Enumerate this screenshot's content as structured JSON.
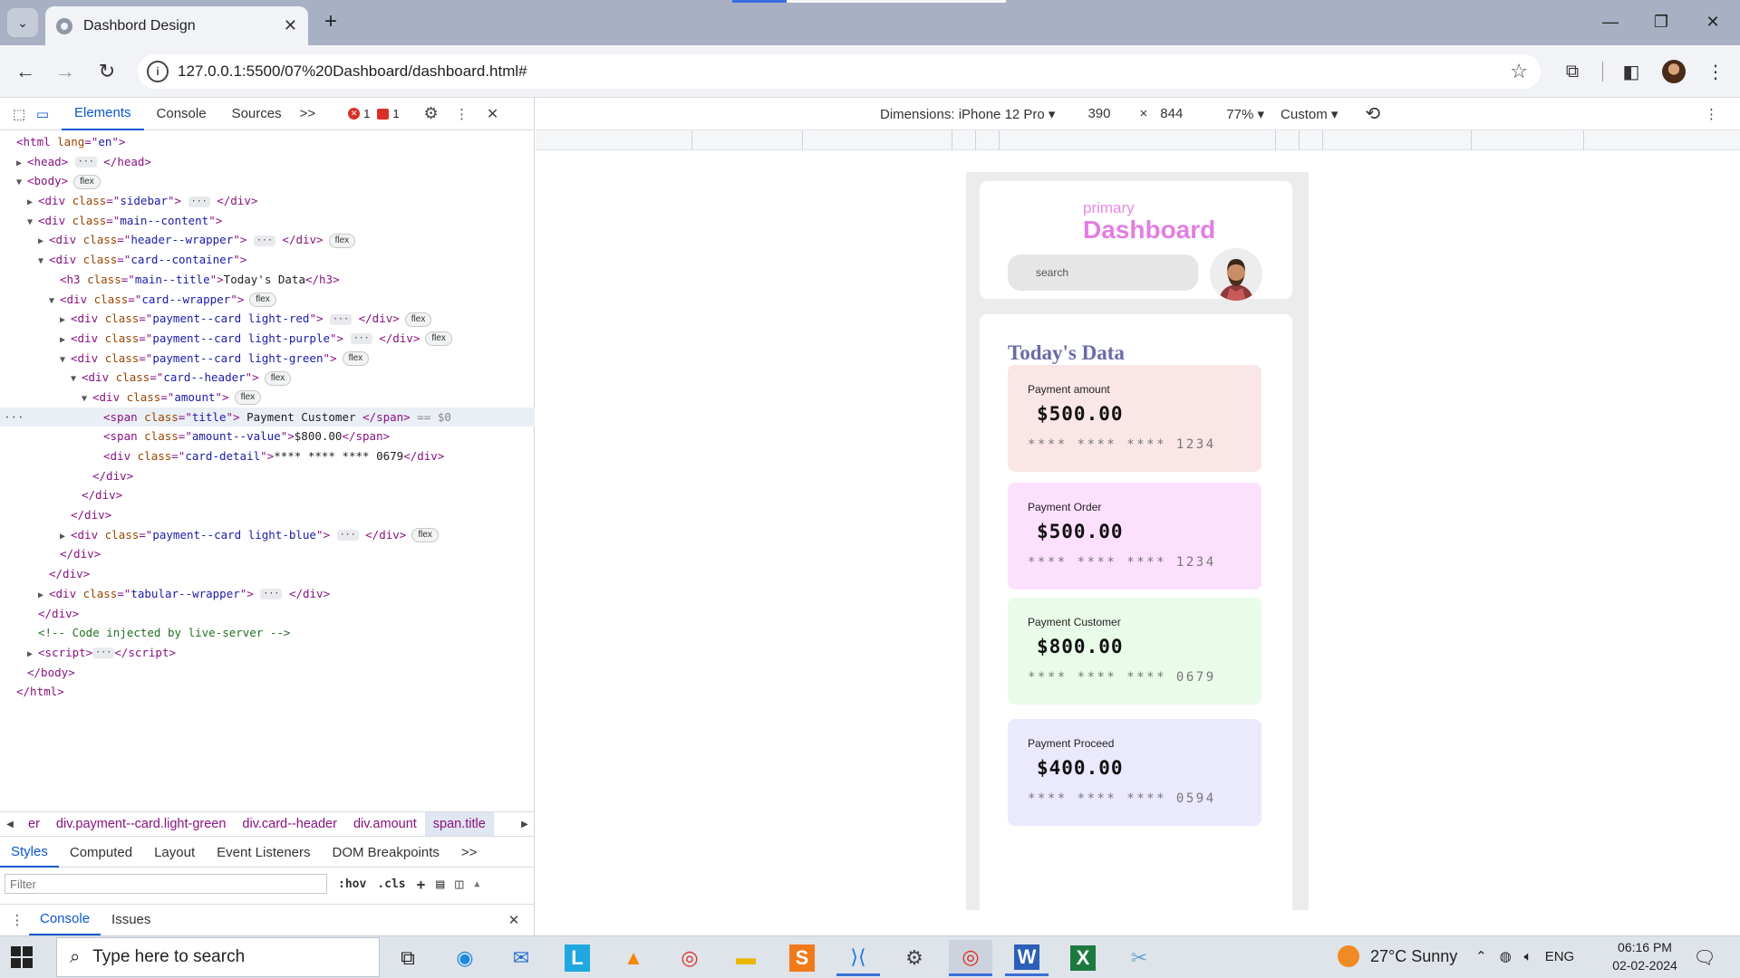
{
  "browser": {
    "tab_title": "Dashbord Design",
    "url": "127.0.0.1:5500/07%20Dashboard/dashboard.html#"
  },
  "devtools": {
    "tabs": [
      "Elements",
      "Console",
      "Sources"
    ],
    "more_tabs": ">>",
    "errors": "1",
    "issues": "1",
    "dom_lines": [
      {
        "indent": 1,
        "html": "<span class=\"t-tag\">&lt;html </span><span class=\"t-attr\">lang</span><span class=\"t-tag\">=\"</span><span class=\"t-val\">en</span><span class=\"t-tag\">\"&gt;</span>"
      },
      {
        "indent": 2,
        "tri": "right",
        "html": "<span class=\"t-tag\">&lt;head&gt;</span> <span class=\"ell\">···</span> <span class=\"t-tag\">&lt;/head&gt;</span>"
      },
      {
        "indent": 2,
        "tri": "down",
        "html": "<span class=\"t-tag\">&lt;body&gt;</span>",
        "badge": "flex"
      },
      {
        "indent": 3,
        "tri": "right",
        "html": "<span class=\"t-tag\">&lt;div </span><span class=\"t-attr\">class</span><span class=\"t-tag\">=\"</span><span class=\"t-val\">sidebar</span><span class=\"t-tag\">\"&gt;</span> <span class=\"ell\">···</span> <span class=\"t-tag\">&lt;/div&gt;</span>"
      },
      {
        "indent": 3,
        "tri": "down",
        "html": "<span class=\"t-tag\">&lt;div </span><span class=\"t-attr\">class</span><span class=\"t-tag\">=\"</span><span class=\"t-val\">main--content</span><span class=\"t-tag\">\"&gt;</span>"
      },
      {
        "indent": 4,
        "tri": "right",
        "html": "<span class=\"t-tag\">&lt;div </span><span class=\"t-attr\">class</span><span class=\"t-tag\">=\"</span><span class=\"t-val\">header--wrapper</span><span class=\"t-tag\">\"&gt;</span> <span class=\"ell\">···</span> <span class=\"t-tag\">&lt;/div&gt;</span>",
        "badge": "flex"
      },
      {
        "indent": 4,
        "tri": "down",
        "html": "<span class=\"t-tag\">&lt;div </span><span class=\"t-attr\">class</span><span class=\"t-tag\">=\"</span><span class=\"t-val\">card--container</span><span class=\"t-tag\">\"&gt;</span>"
      },
      {
        "indent": 5,
        "html": "<span class=\"t-tag\">&lt;h3 </span><span class=\"t-attr\">class</span><span class=\"t-tag\">=\"</span><span class=\"t-val\">main--title</span><span class=\"t-tag\">\"&gt;</span><span class=\"t-text\">Today's Data</span><span class=\"t-tag\">&lt;/h3&gt;</span>"
      },
      {
        "indent": 5,
        "tri": "down",
        "html": "<span class=\"t-tag\">&lt;div </span><span class=\"t-attr\">class</span><span class=\"t-tag\">=\"</span><span class=\"t-val\">card--wrapper</span><span class=\"t-tag\">\"&gt;</span>",
        "badge": "flex"
      },
      {
        "indent": 6,
        "tri": "right",
        "html": "<span class=\"t-tag\">&lt;div </span><span class=\"t-attr\">class</span><span class=\"t-tag\">=\"</span><span class=\"t-val\">payment--card light-red</span><span class=\"t-tag\">\"&gt;</span> <span class=\"ell\">···</span> <span class=\"t-tag\">&lt;/div&gt;</span>",
        "badge": "flex"
      },
      {
        "indent": 6,
        "tri": "right",
        "html": "<span class=\"t-tag\">&lt;div </span><span class=\"t-attr\">class</span><span class=\"t-tag\">=\"</span><span class=\"t-val\">payment--card light-purple</span><span class=\"t-tag\">\"&gt;</span> <span class=\"ell\">···</span> <span class=\"t-tag\">&lt;/div&gt;</span>",
        "badge": "flex"
      },
      {
        "indent": 6,
        "tri": "down",
        "html": "<span class=\"t-tag\">&lt;div </span><span class=\"t-attr\">class</span><span class=\"t-tag\">=\"</span><span class=\"t-val\">payment--card light-green</span><span class=\"t-tag\">\"&gt;</span>",
        "badge": "flex"
      },
      {
        "indent": 7,
        "tri": "down",
        "html": "<span class=\"t-tag\">&lt;div </span><span class=\"t-attr\">class</span><span class=\"t-tag\">=\"</span><span class=\"t-val\">card--header</span><span class=\"t-tag\">\"&gt;</span>",
        "badge": "flex"
      },
      {
        "indent": 8,
        "tri": "down",
        "html": "<span class=\"t-tag\">&lt;div </span><span class=\"t-attr\">class</span><span class=\"t-tag\">=\"</span><span class=\"t-val\">amount</span><span class=\"t-tag\">\"&gt;</span>",
        "badge": "flex"
      },
      {
        "indent": 9,
        "selected": true,
        "html": "<span class=\"t-tag\">&lt;span </span><span class=\"t-attr\">class</span><span class=\"t-tag\">=\"</span><span class=\"t-val\">title</span><span class=\"t-tag\">\"&gt;</span><span class=\"t-text\"> Payment Customer </span><span class=\"t-tag\">&lt;/span&gt;</span> <span class=\"t-dim\">== $0</span>"
      },
      {
        "indent": 9,
        "html": "<span class=\"t-tag\">&lt;span </span><span class=\"t-attr\">class</span><span class=\"t-tag\">=\"</span><span class=\"t-val\">amount--value</span><span class=\"t-tag\">\"&gt;</span><span class=\"t-text\">$800.00</span><span class=\"t-tag\">&lt;/span&gt;</span>"
      },
      {
        "indent": 9,
        "html": "<span class=\"t-tag\">&lt;div </span><span class=\"t-attr\">class</span><span class=\"t-tag\">=\"</span><span class=\"t-val\">card-detail</span><span class=\"t-tag\">\"&gt;</span><span class=\"t-text\">**** **** **** 0679</span><span class=\"t-tag\">&lt;/div&gt;</span>"
      },
      {
        "indent": 8,
        "html": "<span class=\"t-tag\">&lt;/div&gt;</span>"
      },
      {
        "indent": 7,
        "html": "<span class=\"t-tag\">&lt;/div&gt;</span>"
      },
      {
        "indent": 6,
        "html": "<span class=\"t-tag\">&lt;/div&gt;</span>"
      },
      {
        "indent": 6,
        "tri": "right",
        "html": "<span class=\"t-tag\">&lt;div </span><span class=\"t-attr\">class</span><span class=\"t-tag\">=\"</span><span class=\"t-val\">payment--card light-blue</span><span class=\"t-tag\">\"&gt;</span> <span class=\"ell\">···</span> <span class=\"t-tag\">&lt;/div&gt;</span>",
        "badge": "flex"
      },
      {
        "indent": 5,
        "html": "<span class=\"t-tag\">&lt;/div&gt;</span>"
      },
      {
        "indent": 4,
        "html": "<span class=\"t-tag\">&lt;/div&gt;</span>"
      },
      {
        "indent": 4,
        "tri": "right",
        "html": "<span class=\"t-tag\">&lt;div </span><span class=\"t-attr\">class</span><span class=\"t-tag\">=\"</span><span class=\"t-val\">tabular--wrapper</span><span class=\"t-tag\">\"&gt;</span> <span class=\"ell\">···</span> <span class=\"t-tag\">&lt;/div&gt;</span>"
      },
      {
        "indent": 3,
        "html": "<span class=\"t-tag\">&lt;/div&gt;</span>"
      },
      {
        "indent": 3,
        "html": "<span class=\"t-comment\">&lt;!-- Code injected by live-server --&gt;</span>"
      },
      {
        "indent": 3,
        "tri": "right",
        "html": "<span class=\"t-tag\">&lt;script&gt;</span><span class=\"ell\">···</span><span class=\"t-tag\">&lt;/script&gt;</span>"
      },
      {
        "indent": 2,
        "html": "<span class=\"t-tag\">&lt;/body&gt;</span>"
      },
      {
        "indent": 1,
        "html": "<span class=\"t-tag\">&lt;/html&gt;</span>"
      }
    ],
    "breadcrumbs": [
      "er",
      "div.payment--card.light-green",
      "div.card--header",
      "div.amount",
      "span.title"
    ],
    "styles_tabs": [
      "Styles",
      "Computed",
      "Layout",
      "Event Listeners",
      "DOM Breakpoints"
    ],
    "filter_placeholder": "Filter",
    "hov": ":hov",
    "cls": ".cls",
    "drawer_tabs": [
      "Console",
      "Issues"
    ]
  },
  "device_toolbar": {
    "dimensions_label": "Dimensions: iPhone 12 Pro",
    "width": "390",
    "times": "×",
    "height": "844",
    "zoom": "77%",
    "throttle": "Custom"
  },
  "page": {
    "brand_sub": "primary",
    "brand_title": "Dashboard",
    "search_placeholder": "search",
    "main_title": "Today's Data",
    "cards": [
      {
        "title": "Payment amount",
        "amount": "$500.00",
        "detail": "**** **** **** 1234",
        "color": "#fae6e6"
      },
      {
        "title": "Payment Order",
        "amount": "$500.00",
        "detail": "**** **** **** 1234",
        "color": "#fde0fd"
      },
      {
        "title": "Payment Customer",
        "amount": "$800.00",
        "detail": "**** **** **** 0679",
        "color": "#e9fbe9"
      },
      {
        "title": "Payment Proceed",
        "amount": "$400.00",
        "detail": "**** **** **** 0594",
        "color": "#eae9fd"
      }
    ]
  },
  "taskbar": {
    "search_placeholder": "Type here to search",
    "weather": "27°C  Sunny",
    "lang": "ENG",
    "time": "06:16 PM",
    "date": "02-02-2024"
  }
}
